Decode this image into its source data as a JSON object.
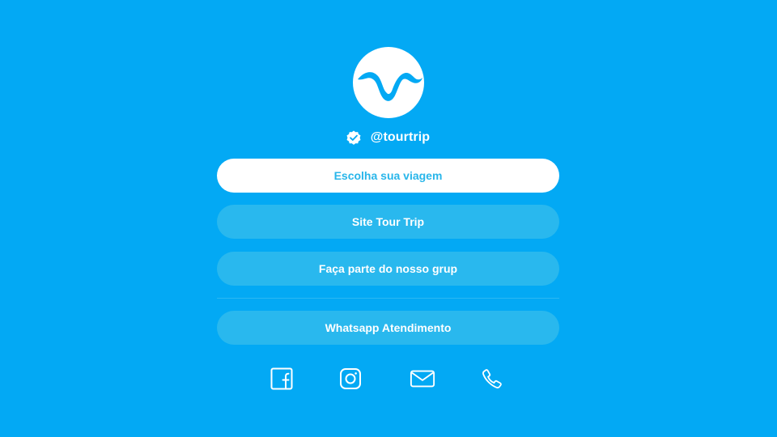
{
  "profile": {
    "handle": "@tourtrip",
    "verified": true
  },
  "links": [
    {
      "label": "Escolha sua viagem",
      "style": "primary"
    },
    {
      "label": "Site Tour Trip",
      "style": "secondary"
    },
    {
      "label": "Faça parte do nosso grup",
      "style": "secondary"
    },
    {
      "label": "Whatsapp Atendimento",
      "style": "secondary"
    }
  ],
  "socials": [
    {
      "icon": "facebook-icon"
    },
    {
      "icon": "instagram-icon"
    },
    {
      "icon": "mail-icon"
    },
    {
      "icon": "phone-icon"
    }
  ],
  "colors": {
    "background": "#03a9f4",
    "primary_button_bg": "#ffffff",
    "primary_button_text": "#29b6ea",
    "secondary_button_bg": "#29b8ee",
    "secondary_button_text": "#ffffff"
  }
}
